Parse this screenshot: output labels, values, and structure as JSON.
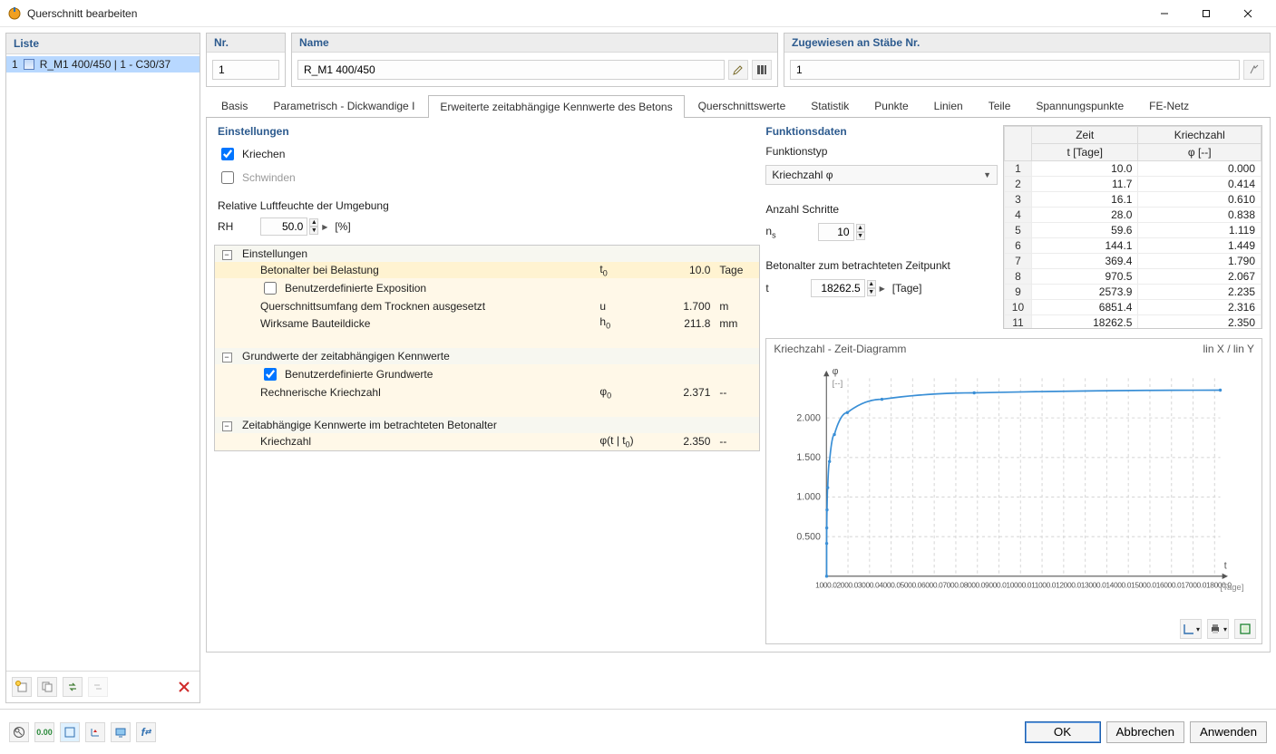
{
  "window": {
    "title": "Querschnitt bearbeiten"
  },
  "list": {
    "header": "Liste",
    "items": [
      {
        "n": "1",
        "label": "R_M1 400/450 | 1 - C30/37",
        "selected": true
      }
    ]
  },
  "top": {
    "nr_header": "Nr.",
    "nr_value": "1",
    "name_header": "Name",
    "name_value": "R_M1 400/450",
    "assigned_header": "Zugewiesen an Stäbe Nr.",
    "assigned_value": "1"
  },
  "tabs": [
    "Basis",
    "Parametrisch - Dickwandige I",
    "Erweiterte zeitabhängige Kennwerte des Betons",
    "Querschnittswerte",
    "Statistik",
    "Punkte",
    "Linien",
    "Teile",
    "Spannungspunkte",
    "FE-Netz"
  ],
  "tabs_selected_index": 2,
  "settings": {
    "title": "Einstellungen",
    "kriechen_label": "Kriechen",
    "kriechen_checked": true,
    "schwinden_label": "Schwinden",
    "schwinden_checked": false,
    "rh_title": "Relative Luftfeuchte der Umgebung",
    "rh_sym": "RH",
    "rh_value": "50.0",
    "rh_unit": "[%]"
  },
  "props": {
    "sec1": {
      "title": "Einstellungen",
      "r1": {
        "label": "Betonalter bei Belastung",
        "sym": "t0",
        "val": "10.0",
        "unit": "Tage"
      },
      "r2": {
        "label": "Benutzerdefinierte Exposition",
        "checked": false
      },
      "r3": {
        "label": "Querschnittsumfang dem Trocknen ausgesetzt",
        "sym": "u",
        "val": "1.700",
        "unit": "m"
      },
      "r4": {
        "label": "Wirksame Bauteildicke",
        "sym": "h0",
        "val": "211.8",
        "unit": "mm"
      }
    },
    "sec2": {
      "title": "Grundwerte der zeitabhängigen Kennwerte",
      "r1": {
        "label": "Benutzerdefinierte Grundwerte",
        "checked": true
      },
      "r2": {
        "label": "Rechnerische Kriechzahl",
        "sym": "φ0",
        "val": "2.371",
        "unit": "--"
      }
    },
    "sec3": {
      "title": "Zeitabhängige Kennwerte im betrachteten Betonalter",
      "r1": {
        "label": "Kriechzahl",
        "sym": "φ(t | t0)",
        "val": "2.350",
        "unit": "--"
      }
    }
  },
  "fdata": {
    "title": "Funktionsdaten",
    "type_label": "Funktionstyp",
    "type_value": "Kriechzahl φ",
    "steps_label": "Anzahl Schritte",
    "steps_sym": "ns",
    "steps_value": "10",
    "age_label": "Betonalter zum betrachteten Zeitpunkt",
    "age_sym": "t",
    "age_value": "18262.5",
    "age_unit": "[Tage]"
  },
  "datatable": {
    "col1": {
      "l1": "Zeit",
      "l2": "t [Tage]"
    },
    "col2": {
      "l1": "Kriechzahl",
      "l2": "φ [--]"
    },
    "rows": [
      {
        "n": "1",
        "t": "10.0",
        "p": "0.000"
      },
      {
        "n": "2",
        "t": "11.7",
        "p": "0.414"
      },
      {
        "n": "3",
        "t": "16.1",
        "p": "0.610"
      },
      {
        "n": "4",
        "t": "28.0",
        "p": "0.838"
      },
      {
        "n": "5",
        "t": "59.6",
        "p": "1.119"
      },
      {
        "n": "6",
        "t": "144.1",
        "p": "1.449"
      },
      {
        "n": "7",
        "t": "369.4",
        "p": "1.790"
      },
      {
        "n": "8",
        "t": "970.5",
        "p": "2.067"
      },
      {
        "n": "9",
        "t": "2573.9",
        "p": "2.235"
      },
      {
        "n": "10",
        "t": "6851.4",
        "p": "2.316"
      },
      {
        "n": "11",
        "t": "18262.5",
        "p": "2.350"
      }
    ]
  },
  "chart": {
    "title": "Kriechzahl - Zeit-Diagramm",
    "scale": "lin X / lin Y",
    "y_sym": "φ",
    "y_unit": "[--]",
    "x_sym": "t",
    "x_unit": "[Tage]"
  },
  "chart_data": {
    "type": "line",
    "title": "Kriechzahl - Zeit-Diagramm",
    "xlabel": "t [Tage]",
    "ylabel": "φ [--]",
    "xlim": [
      0,
      18262.5
    ],
    "ylim": [
      0,
      2.5
    ],
    "x_ticks": [
      1000,
      2000,
      3000,
      4000,
      5000,
      6000,
      7000,
      8000,
      9000,
      10000,
      11000,
      12000,
      13000,
      14000,
      15000,
      16000,
      17000,
      18000
    ],
    "y_ticks": [
      0.5,
      1.0,
      1.5,
      2.0
    ],
    "series": [
      {
        "name": "Kriechzahl φ",
        "x": [
          10.0,
          11.7,
          16.1,
          28.0,
          59.6,
          144.1,
          369.4,
          970.5,
          2573.9,
          6851.4,
          18262.5
        ],
        "y": [
          0.0,
          0.414,
          0.61,
          0.838,
          1.119,
          1.449,
          1.79,
          2.067,
          2.235,
          2.316,
          2.35
        ]
      }
    ]
  },
  "footer": {
    "ok": "OK",
    "cancel": "Abbrechen",
    "apply": "Anwenden"
  }
}
